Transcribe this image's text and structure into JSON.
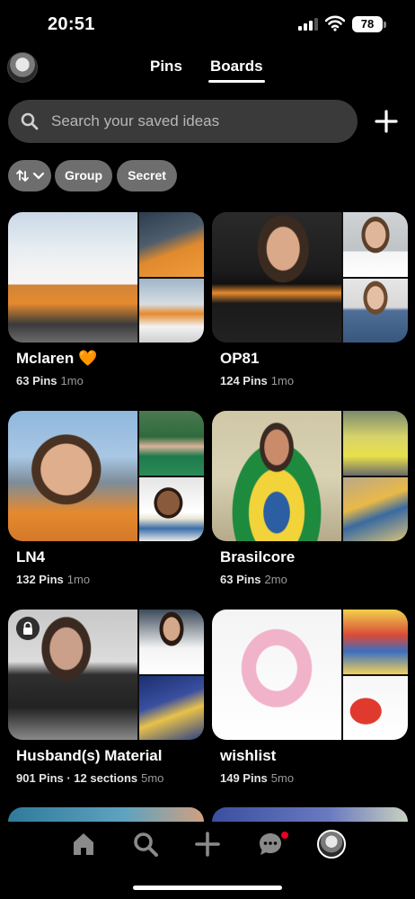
{
  "status": {
    "time": "20:51",
    "battery": "78"
  },
  "tabs": {
    "pins": "Pins",
    "boards": "Boards"
  },
  "search": {
    "placeholder": "Search your saved ideas"
  },
  "filters": {
    "group": "Group",
    "secret": "Secret"
  },
  "boards": [
    {
      "title": "Mclaren 🧡",
      "pins": "63 Pins",
      "age": "1mo"
    },
    {
      "title": "OP81",
      "pins": "124 Pins",
      "age": "1mo"
    },
    {
      "title": "LN4",
      "pins": "132 Pins",
      "age": "1mo"
    },
    {
      "title": "Brasilcore",
      "pins": "63 Pins",
      "age": "2mo"
    },
    {
      "title": "Husband(s) Material",
      "pins": "901 Pins · 12 sections",
      "age": "5mo",
      "secret": true
    },
    {
      "title": "wishlist",
      "pins": "149 Pins",
      "age": "5mo"
    }
  ],
  "icons": [
    "signal-icon",
    "wifi-icon",
    "battery-icon",
    "search-icon",
    "plus-icon",
    "sort-icon",
    "chevron-down-icon",
    "lock-icon",
    "home-icon",
    "plus-icon",
    "chat-icon",
    "profile-avatar"
  ],
  "colors": {
    "background": "#000000",
    "search_bg": "#3a3a3a",
    "chip_bg": "#6e6e6e",
    "notification": "#e60023"
  }
}
